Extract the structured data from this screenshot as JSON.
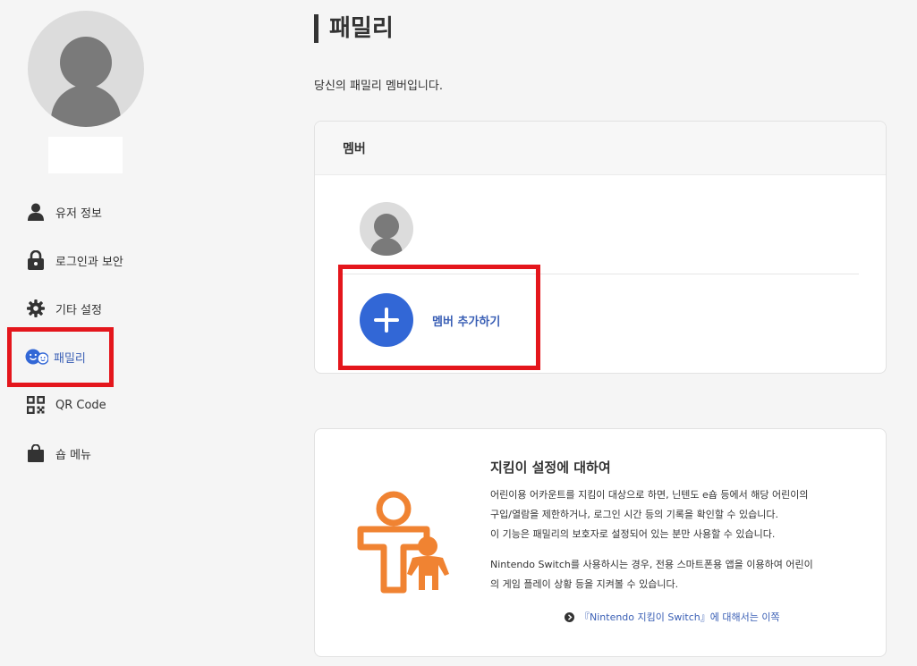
{
  "sidebar": {
    "items": [
      {
        "label": "유저 정보",
        "icon": "user-icon"
      },
      {
        "label": "로그인과 보안",
        "icon": "lock-icon"
      },
      {
        "label": "기타 설정",
        "icon": "gear-icon"
      },
      {
        "label": "패밀리",
        "icon": "family-icon",
        "active": true
      },
      {
        "label": "QR Code",
        "icon": "qr-code-icon"
      },
      {
        "label": "숍 메뉴",
        "icon": "shopping-bag-icon"
      }
    ]
  },
  "main": {
    "title": "패밀리",
    "description": "당신의 패밀리 멤버입니다.",
    "members_card": {
      "header": "멤버",
      "add_member_label": "멤버 추가하기"
    },
    "info_card": {
      "title": "지킴이 설정에 대하여",
      "paragraph1_line1": "어린이용 어카운트를 지킴이 대상으로 하면, 닌텐도 e숍 등에서 해당 어린이의",
      "paragraph1_line2": "구입/열람을 제한하거나, 로그인 시간 등의 기록을 확인할 수 있습니다.",
      "paragraph1_line3": "이 기능은 패밀리의 보호자로 설정되어 있는 분만 사용할 수 있습니다.",
      "paragraph2_line1": "Nintendo Switch를 사용하시는 경우, 전용 스마트폰용 앱을 이용하여 어린이",
      "paragraph2_line2": "의 게임 플레이 상황 등을 지켜볼 수 있습니다.",
      "link_label": "『Nintendo 지킴이 Switch』에 대해서는 이쪽"
    }
  },
  "colors": {
    "accent": "#3267d6",
    "link": "#3a5fb5",
    "highlight": "#e4161c",
    "illustration": "#f08332"
  }
}
